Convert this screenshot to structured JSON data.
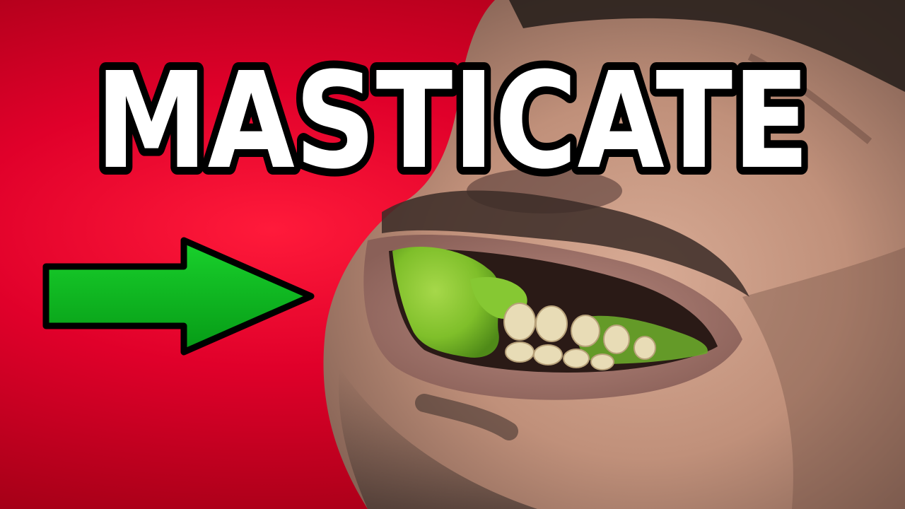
{
  "thumbnail": {
    "title_word": "MASTICATE",
    "colors": {
      "background_red": "#e0002a",
      "title_fill": "#ffffff",
      "title_outline": "#000000",
      "arrow_green": "#0bbf1e",
      "food_green": "#7fbf2a",
      "skin": "#c99a86"
    },
    "icons": {
      "arrow": "arrow-right-icon"
    }
  }
}
